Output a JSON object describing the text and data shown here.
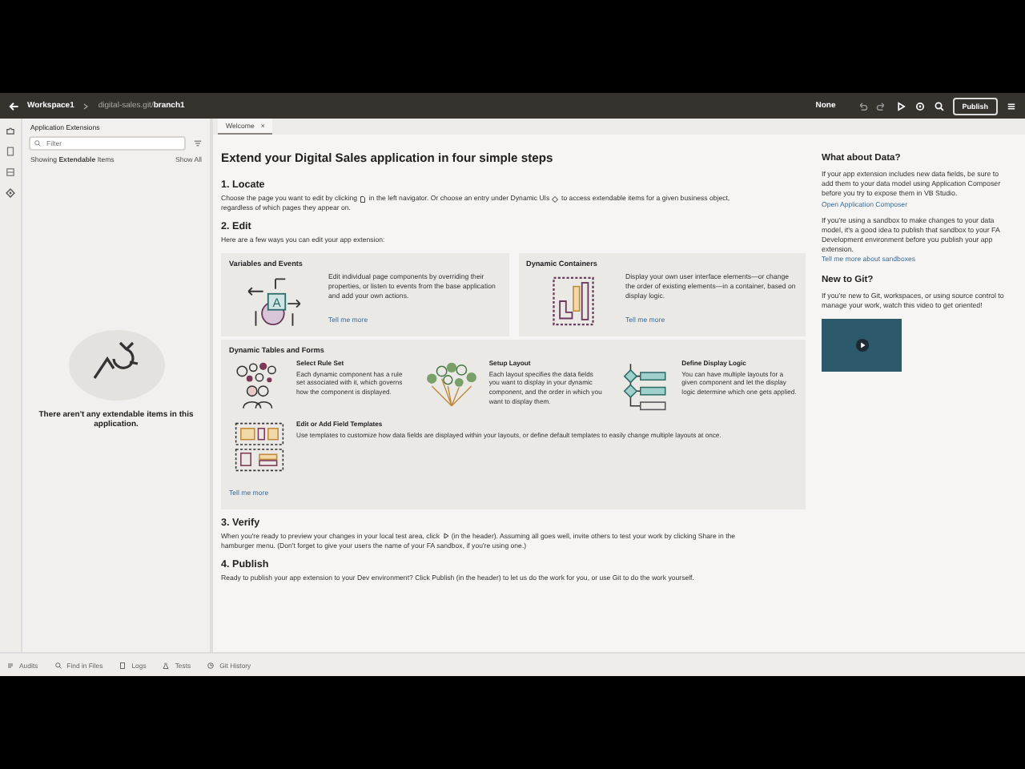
{
  "header": {
    "workspace": "Workspace1",
    "repo": "digital-sales.git/",
    "branch": "branch1",
    "mode": "None",
    "publish": "Publish"
  },
  "left_panel": {
    "title": "Application Extensions",
    "filter_placeholder": "Filter",
    "showing": "Showing **Extendable** Items",
    "show_all": "Show All",
    "empty_message": "There aren't any extendable items in this application."
  },
  "tabs": [
    {
      "label": "Welcome",
      "selected": true,
      "close": "×"
    }
  ],
  "welcome": {
    "title": "Extend your Digital Sales application in four simple steps",
    "locate": {
      "heading": "1. Locate",
      "text_1": "Choose the page you want to edit by clicking",
      "text_2": "in the left navigator. Or choose an entry under Dynamic UIs",
      "text_3": "to access extendable items for a given business object,",
      "text_4": "regardless of which pages they appear on."
    },
    "edit": {
      "heading": "2. Edit",
      "intro": "Here are a few ways you can edit your app extension:",
      "cards": [
        {
          "kind": "variables",
          "art_letter": "A",
          "title": "Variables and Events",
          "text": "Edit individual page components by overriding their properties, or listen to events from the base application and add your own actions.",
          "link": "Tell me more"
        },
        {
          "kind": "containers",
          "title": "Dynamic Containers",
          "text": "Display your own user interface elements—or change the order of existing elements—in a container, based on display logic.",
          "link": "Tell me more"
        }
      ],
      "tables": {
        "title": "Dynamic Tables and Forms",
        "items": [
          {
            "kind": "rules",
            "title": "Select Rule Set",
            "text": "Each dynamic component has a rule set associated with it, which governs how the component is displayed."
          },
          {
            "kind": "layout",
            "title": "Setup Layout",
            "text": "Each layout specifies the data fields you want to display in your dynamic component, and the order in which you want to display them."
          },
          {
            "kind": "logic",
            "title": "Define Display Logic",
            "text": "You can have multiple layouts for a given component and let the display logic determine which one gets applied."
          },
          {
            "kind": "templates",
            "title": "Edit or Add Field Templates",
            "text": "Use templates to customize how data fields are displayed within your layouts, or define default templates to easily change multiple layouts at once."
          }
        ],
        "link": "Tell me more"
      }
    },
    "verify": {
      "heading": "3. Verify",
      "text_1": "When you're ready to preview your changes in your local test area, click",
      "text_2": "(in the header). Assuming all goes well, invite others to test your work by clicking Share in the",
      "text_3": "hamburger menu. (Don't forget to give your users the name of your FA sandbox, if you're using one.)"
    },
    "publish": {
      "heading": "4. Publish",
      "text": "Ready to publish your app extension to your Dev environment? Click Publish (in the header) to let us do the work for you, or use Git to do the work yourself."
    }
  },
  "sidebar": {
    "data_heading": "What about Data?",
    "data_text_1": "If your app extension includes new data fields, be sure to add them to your data model using Application Composer before you try to expose them in VB Studio.",
    "data_link_1": "Open Application Composer",
    "data_text_2": "If you're using a sandbox to make changes to your data model, it's a good idea to publish that sandbox to your FA Development environment before you publish your app extension.",
    "data_link_2": "Tell me more about sandboxes",
    "git_heading": "New to Git?",
    "git_text": "If you're new to Git, workspaces, or using source control to manage your work, watch this video to get oriented!"
  },
  "status_bar": [
    {
      "kind": "audits",
      "label": "Audits"
    },
    {
      "kind": "find",
      "label": "Find in Files"
    },
    {
      "kind": "logs",
      "label": "Logs"
    },
    {
      "kind": "tests",
      "label": "Tests"
    },
    {
      "kind": "git",
      "label": "Git History"
    }
  ]
}
